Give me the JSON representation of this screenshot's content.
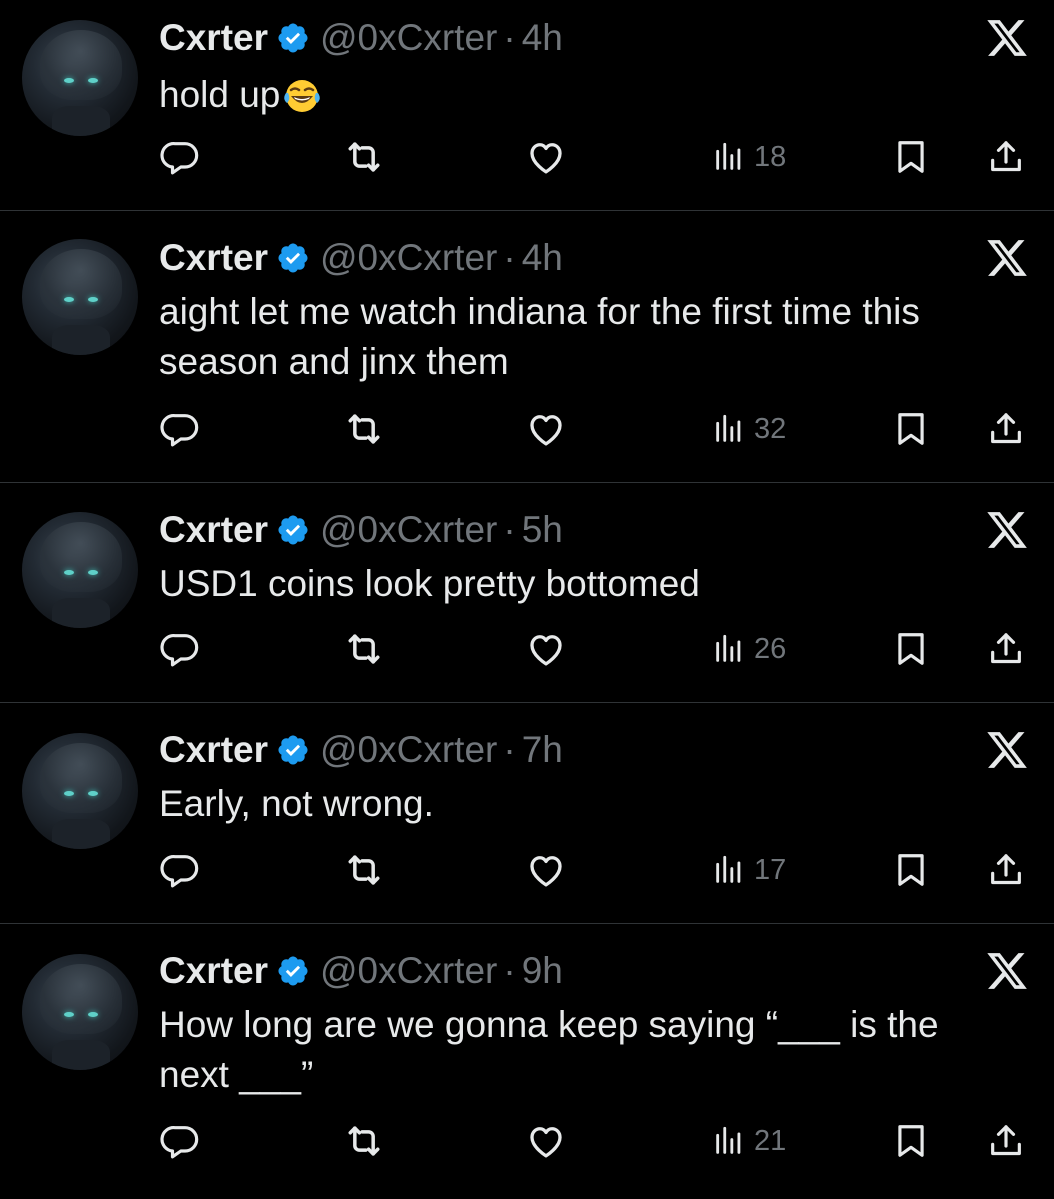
{
  "tweets": [
    {
      "name": "Cxrter",
      "handle": "@0xCxrter",
      "separator": "·",
      "time": "4h",
      "text": "hold up",
      "emoji": "face-with-tears-of-joy",
      "views": "18"
    },
    {
      "name": "Cxrter",
      "handle": "@0xCxrter",
      "separator": "·",
      "time": "4h",
      "text_line1": "aight let me watch indiana for the first time this",
      "text_line2": "season and jinx them",
      "views": "32"
    },
    {
      "name": "Cxrter",
      "handle": "@0xCxrter",
      "separator": "·",
      "time": "5h",
      "text": "USD1 coins look pretty bottomed",
      "views": "26"
    },
    {
      "name": "Cxrter",
      "handle": "@0xCxrter",
      "separator": "·",
      "time": "7h",
      "text": "Early, not wrong.",
      "views": "17"
    },
    {
      "name": "Cxrter",
      "handle": "@0xCxrter",
      "separator": "·",
      "time": "9h",
      "text_line1": "How long are we gonna keep saying “___ is the",
      "text_line2": "next ___”",
      "views": "21"
    }
  ],
  "icons": {
    "verified": "verified-badge-icon",
    "platform": "x-logo-icon",
    "reply": "reply-icon",
    "repost": "repost-icon",
    "like": "like-icon",
    "views": "views-icon",
    "bookmark": "bookmark-icon",
    "share": "share-icon"
  },
  "colors": {
    "background": "#000000",
    "text": "#e7e9ea",
    "muted": "#71767b",
    "verified": "#1d9bf0",
    "divider": "#2f3336"
  }
}
